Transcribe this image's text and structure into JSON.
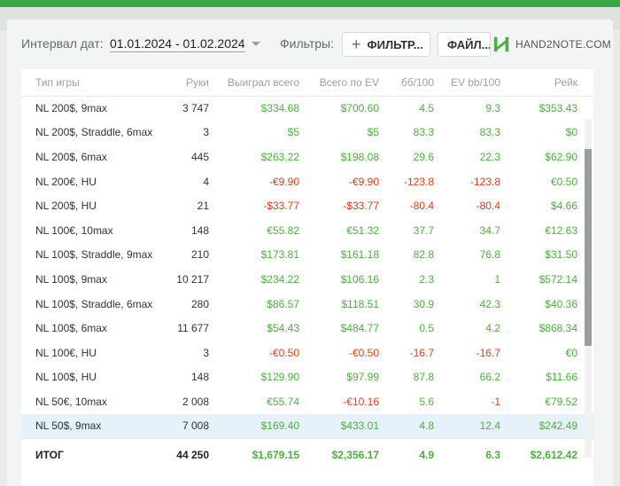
{
  "toolbar": {
    "interval_label": "Интервал дат:",
    "interval_value": "01.01.2024 - 01.02.2024",
    "filters_label": "Фильтры:",
    "filter_button": "ФИЛЬТР...",
    "file_button": "ФАЙЛ...",
    "logo_text": "HAND2NOTE.COM"
  },
  "colors": {
    "positive": "#4caf3f",
    "negative": "#d9401b",
    "accent": "#3aa845",
    "highlight_row": "#e6f2f9"
  },
  "table": {
    "headers": [
      "Тип игры",
      "Руки",
      "Выиграл всего",
      "Всего по EV",
      "бб/100",
      "EV bb/100",
      "Рейк"
    ],
    "rows": [
      [
        "NL 200$, 9max",
        "3 747",
        "$334.68",
        "$700.60",
        "4.5",
        "9.3",
        "$353.43"
      ],
      [
        "NL 200$, Straddle, 6max",
        "3",
        "$5",
        "$5",
        "83.3",
        "83.3",
        "$0"
      ],
      [
        "NL 200$, 6max",
        "445",
        "$263.22",
        "$198.08",
        "29.6",
        "22.3",
        "$62.90"
      ],
      [
        "NL 200€, HU",
        "4",
        "-€9.90",
        "-€9.90",
        "-123.8",
        "-123.8",
        "€0.50"
      ],
      [
        "NL 200$, HU",
        "21",
        "-$33.77",
        "-$33.77",
        "-80.4",
        "-80.4",
        "$4.66"
      ],
      [
        "NL 100€, 10max",
        "148",
        "€55.82",
        "€51.32",
        "37.7",
        "34.7",
        "€12.63"
      ],
      [
        "NL 100$, Straddle, 9max",
        "210",
        "$173.81",
        "$161.18",
        "82.8",
        "76.8",
        "$31.50"
      ],
      [
        "NL 100$, 9max",
        "10 217",
        "$234.22",
        "$106.16",
        "2.3",
        "1",
        "$572.14"
      ],
      [
        "NL 100$, Straddle, 6max",
        "280",
        "$86.57",
        "$118.51",
        "30.9",
        "42.3",
        "$40.36"
      ],
      [
        "NL 100$, 6max",
        "11 677",
        "$54.43",
        "$484.77",
        "0.5",
        "4.2",
        "$868.34"
      ],
      [
        "NL 100€, HU",
        "3",
        "-€0.50",
        "-€0.50",
        "-16.7",
        "-16.7",
        "€0"
      ],
      [
        "NL 100$, HU",
        "148",
        "$129.90",
        "$97.99",
        "87.8",
        "66.2",
        "$11.66"
      ],
      [
        "NL 50€, 10max",
        "2 008",
        "€55.74",
        "-€10.16",
        "5.6",
        "-1",
        "€79.52"
      ],
      [
        "NL 50$, 9max",
        "7 008",
        "$169.40",
        "$433.01",
        "4.8",
        "12.4",
        "$242.49"
      ]
    ],
    "total": [
      "ИТОГ",
      "44 250",
      "$1,679.15",
      "$2,356.17",
      "4.9",
      "6.3",
      "$2,612.42"
    ]
  }
}
